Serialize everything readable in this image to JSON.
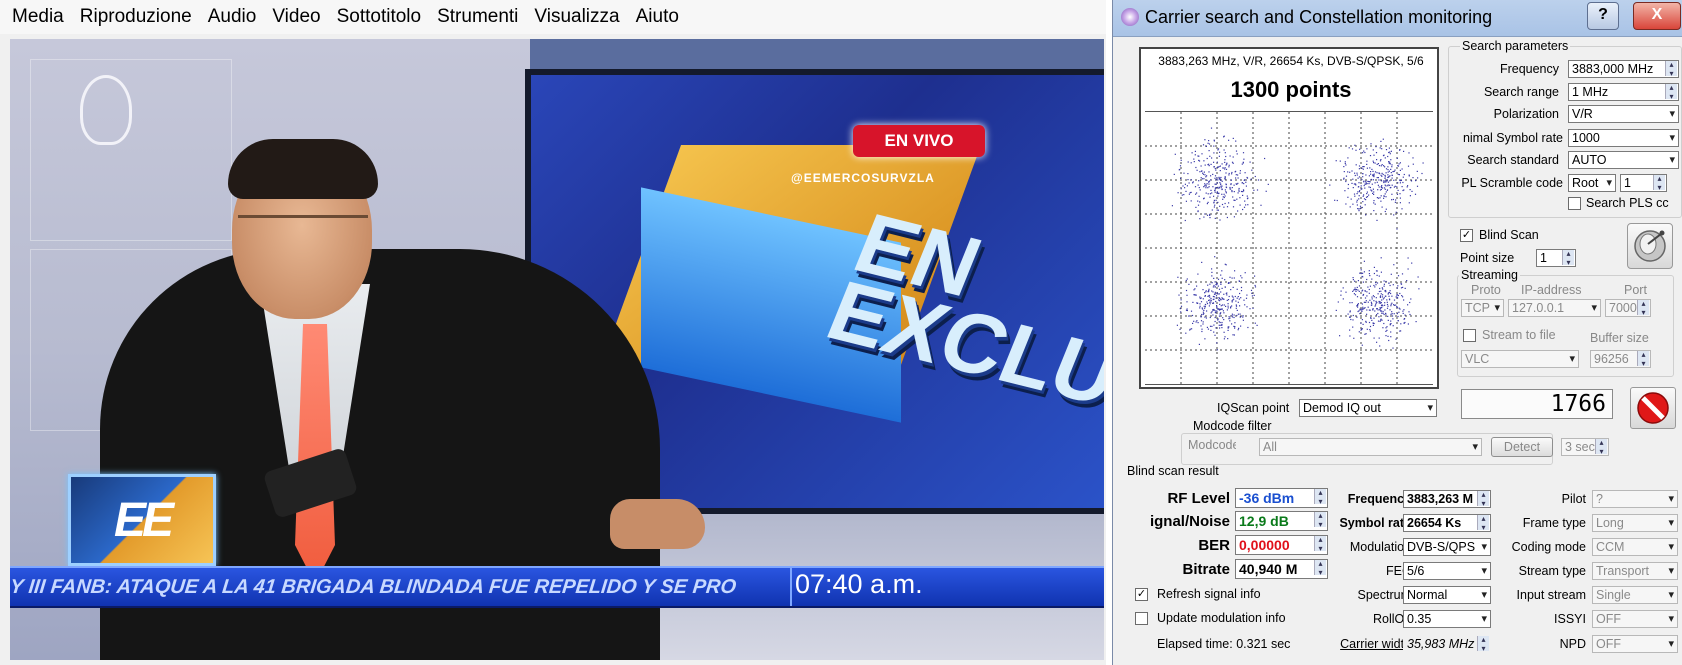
{
  "player": {
    "menu": [
      "Media",
      "Riproduzione",
      "Audio",
      "Video",
      "Sottotitolo",
      "Strumenti",
      "Visualizza",
      "Aiuto"
    ],
    "video": {
      "badge": "EN VIVO",
      "screen_big_text_1": "EN",
      "screen_big_text_2": "EXCLUS",
      "screen_tag": "@EEMERCOSURVZLA",
      "logo": "EE",
      "ticker_text": "Y III FANB: ATAQUE A LA 41 BRIGADA BLINDADA FUE REPELIDO Y SE PRO",
      "ticker_time": "07:40 a.m."
    }
  },
  "dialog": {
    "title": "Carrier search and Constellation monitoring",
    "help_label": "?",
    "close_label": "X",
    "constellation": {
      "info": "3883,263 MHz, V/R, 26654 Ks, DVB-S/QPSK, 5/6",
      "count": "1300 points"
    },
    "search": {
      "title": "Search parameters",
      "frequency_label": "Frequency",
      "frequency_value": "3883,000 MHz",
      "range_label": "Search range",
      "range_value": "1 MHz",
      "polarization_label": "Polarization",
      "polarization_value": "V/R",
      "min_sr_label": "nimal Symbol rate",
      "min_sr_value": "1000",
      "standard_label": "Search standard",
      "standard_value": "AUTO",
      "pls_label": "PL Scramble code",
      "pls_mode": "Root",
      "pls_value": "1",
      "search_pls_label": "Search PLS cc",
      "blind_scan_label": "Blind Scan",
      "point_size_label": "Point size",
      "point_size_value": "1"
    },
    "streaming": {
      "title": "Streaming",
      "proto_label": "Proto",
      "ip_label": "IP-address",
      "port_label": "Port",
      "proto_value": "TCP",
      "ip_value": "127.0.0.1",
      "port_value": "7000",
      "stream_to_file_label": "Stream to file",
      "buffer_label": "Buffer size",
      "player_value": "VLC",
      "buffer_value": "96256"
    },
    "counter": "1766",
    "iqscan": {
      "label": "IQScan point",
      "value": "Demod IQ out"
    },
    "modcode": {
      "title": "Modcode filter",
      "label": "Modcode",
      "value": "All",
      "detect_label": "Detect",
      "sec_value": "3 sec"
    },
    "result": {
      "title": "Blind scan result",
      "rf_level_label": "RF Level",
      "rf_level_value": "-36 dBm",
      "sn_label": "ignal/Noise",
      "sn_value": "12,9 dB",
      "ber_label": "BER",
      "ber_value": "0,00000",
      "bitrate_label": "Bitrate",
      "bitrate_value": "40,940 M",
      "frequency_label": "Frequency",
      "frequency_value": "3883,263 M",
      "sr_label": "Symbol rate",
      "sr_value": "26654 Ks",
      "modulation_label": "Modulation",
      "modulation_value": "DVB-S/QPS",
      "fec_label": "FEC",
      "fec_value": "5/6",
      "spectrum_label": "Spectrum",
      "spectrum_value": "Normal",
      "rolloff_label": "RollOff",
      "rolloff_value": "0.35",
      "carrier_width_label": "Carrier width",
      "carrier_width_value": "35,983 MHz",
      "pilot_label": "Pilot",
      "pilot_value": "?",
      "frame_type_label": "Frame type",
      "frame_type_value": "Long",
      "coding_mode_label": "Coding mode",
      "coding_mode_value": "CCM",
      "stream_type_label": "Stream type",
      "stream_type_value": "Transport",
      "input_stream_label": "Input stream",
      "input_stream_value": "Single",
      "issyi_label": "ISSYI",
      "issyi_value": "OFF",
      "npd_label": "NPD",
      "npd_value": "OFF",
      "refresh_label": "Refresh signal info",
      "update_mod_label": "Update modulation info",
      "elapsed": "Elapsed time: 0.321 sec"
    },
    "colors": {
      "rf_level": "#1a4fd0",
      "signal_noise": "#0a7a1a",
      "ber": "#e0101a"
    },
    "icons": {
      "app": "app-icon",
      "satellite": "satellite-dish-icon",
      "stop": "stop-sign-icon"
    }
  }
}
